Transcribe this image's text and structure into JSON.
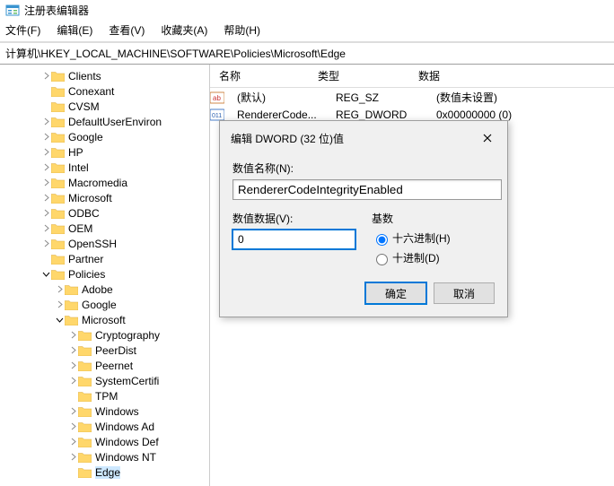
{
  "window": {
    "title": "注册表编辑器"
  },
  "menu": {
    "file": "文件(F)",
    "edit": "编辑(E)",
    "view": "查看(V)",
    "fav": "收藏夹(A)",
    "help": "帮助(H)"
  },
  "addr": "计算机\\HKEY_LOCAL_MACHINE\\SOFTWARE\\Policies\\Microsoft\\Edge",
  "tree": {
    "clients": "Clients",
    "conexant": "Conexant",
    "cvsm": "CVSM",
    "defuser": "DefaultUserEnviron",
    "google": "Google",
    "hp": "HP",
    "intel": "Intel",
    "macro": "Macromedia",
    "microsoft": "Microsoft",
    "odbc": "ODBC",
    "oem": "OEM",
    "openssh": "OpenSSH",
    "partner": "Partner",
    "policies": "Policies",
    "adobe": "Adobe",
    "google2": "Google",
    "microsoft2": "Microsoft",
    "crypto": "Cryptography",
    "peerdist": "PeerDist",
    "peernet": "Peernet",
    "syscert": "SystemCertifi",
    "tpm": "TPM",
    "windows": "Windows",
    "winadv": "Windows Ad",
    "windef": "Windows Def",
    "winnt": "Windows NT",
    "edge": "Edge"
  },
  "list": {
    "hdr": {
      "name": "名称",
      "type": "类型",
      "data": "数据"
    },
    "rows": [
      {
        "name": "(默认)",
        "type": "REG_SZ",
        "data": "(数值未设置)"
      },
      {
        "name": "RendererCode...",
        "type": "REG_DWORD",
        "data": "0x00000000 (0)"
      }
    ]
  },
  "dlg": {
    "title": "编辑 DWORD (32 位)值",
    "name_label": "数值名称(N):",
    "name_value": "RendererCodeIntegrityEnabled",
    "data_label": "数值数据(V):",
    "data_value": "0",
    "radix_label": "基数",
    "hex": "十六进制(H)",
    "dec": "十进制(D)",
    "ok": "确定",
    "cancel": "取消"
  }
}
